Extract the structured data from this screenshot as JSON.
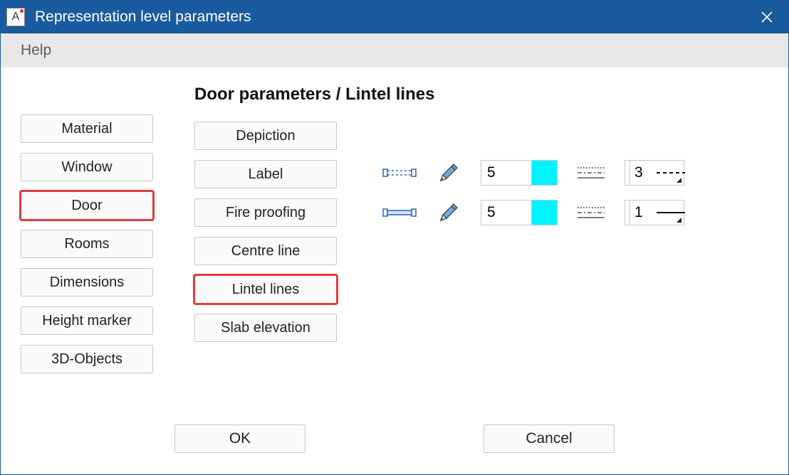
{
  "window": {
    "app_icon_letter": "A",
    "title": "Representation level parameters"
  },
  "menubar": {
    "help": "Help"
  },
  "heading": "Door parameters / Lintel lines",
  "left_tabs": [
    {
      "label": "Material",
      "highlight": false
    },
    {
      "label": "Window",
      "highlight": false
    },
    {
      "label": "Door",
      "highlight": true
    },
    {
      "label": "Rooms",
      "highlight": false
    },
    {
      "label": "Dimensions",
      "highlight": false
    },
    {
      "label": "Height marker",
      "highlight": false
    },
    {
      "label": "3D-Objects",
      "highlight": false
    }
  ],
  "mid_tabs": [
    {
      "label": "Depiction",
      "highlight": false
    },
    {
      "label": "Label",
      "highlight": false
    },
    {
      "label": "Fire proofing",
      "highlight": false
    },
    {
      "label": "Centre line",
      "highlight": false
    },
    {
      "label": "Lintel lines",
      "highlight": true
    },
    {
      "label": "Slab elevation",
      "highlight": false
    }
  ],
  "rows": [
    {
      "pen_value": "5",
      "color": "#00f4ff",
      "linetype_value": "3",
      "linetype_style": "dashed"
    },
    {
      "pen_value": "5",
      "color": "#00f4ff",
      "linetype_value": "1",
      "linetype_style": "solid"
    }
  ],
  "footer": {
    "ok": "OK",
    "cancel": "Cancel"
  }
}
